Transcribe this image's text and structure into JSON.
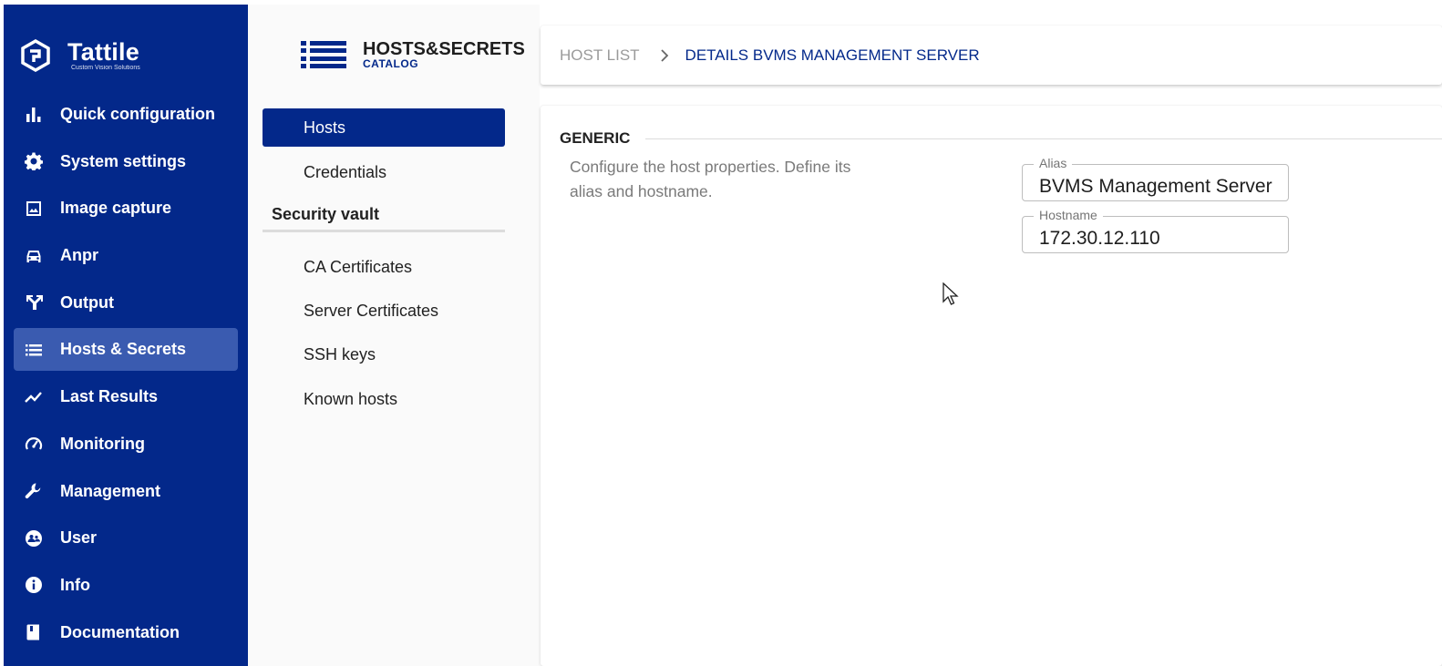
{
  "brand": {
    "name": "Tattile",
    "tagline": "Custom Vision Solutions",
    "accent": "#03288a"
  },
  "sidebar": {
    "items": [
      {
        "label": "Quick configuration",
        "icon": "bar-chart-icon",
        "active": false
      },
      {
        "label": "System settings",
        "icon": "gear-icon",
        "active": false
      },
      {
        "label": "Image capture",
        "icon": "image-icon",
        "active": false
      },
      {
        "label": "Anpr",
        "icon": "car-icon",
        "active": false
      },
      {
        "label": "Output",
        "icon": "fork-arrows-icon",
        "active": false
      },
      {
        "label": "Hosts & Secrets",
        "icon": "list-icon",
        "active": true
      },
      {
        "label": "Last Results",
        "icon": "trending-line-icon",
        "active": false
      },
      {
        "label": "Monitoring",
        "icon": "gauge-icon",
        "active": false
      },
      {
        "label": "Management",
        "icon": "wrench-icon",
        "active": false
      },
      {
        "label": "User",
        "icon": "user-globe-icon",
        "active": false
      },
      {
        "label": "Info",
        "icon": "info-icon",
        "active": false
      },
      {
        "label": "Documentation",
        "icon": "book-icon",
        "active": false
      }
    ]
  },
  "catalog": {
    "title": "HOSTS&SECRETS",
    "subtitle": "CATALOG",
    "menu": {
      "hosts": "Hosts",
      "credentials": "Credentials",
      "section": "Security vault",
      "ca_certificates": "CA Certificates",
      "server_certificates": "Server Certificates",
      "ssh_keys": "SSH keys",
      "known_hosts": "Known hosts"
    }
  },
  "breadcrumb": {
    "parent": "HOST LIST",
    "current": "DETAILS BVMS MANAGEMENT SERVER"
  },
  "generic": {
    "title": "GENERIC",
    "description": "Configure the host properties. Define its alias and hostname.",
    "alias": {
      "label": "Alias",
      "value": "BVMS Management Server"
    },
    "hostname": {
      "label": "Hostname",
      "value": "172.30.12.110"
    }
  }
}
